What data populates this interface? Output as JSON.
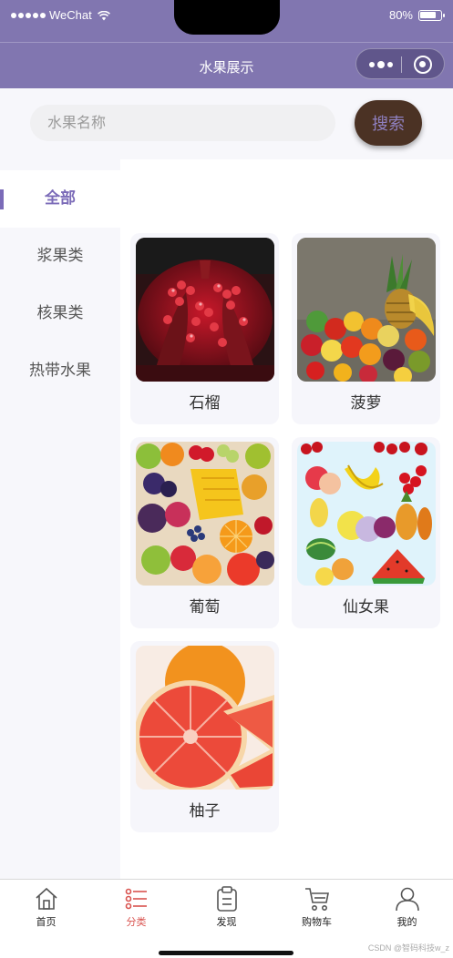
{
  "status": {
    "carrier": "WeChat",
    "battery": "80%",
    "battery_level": 0.8
  },
  "navbar": {
    "title": "水果展示"
  },
  "search": {
    "placeholder": "水果名称",
    "button": "搜索"
  },
  "sidebar": {
    "items": [
      {
        "label": "全部",
        "active": true
      },
      {
        "label": "浆果类",
        "active": false
      },
      {
        "label": "核果类",
        "active": false
      },
      {
        "label": "热带水果",
        "active": false
      }
    ]
  },
  "products": [
    {
      "name": "石榴"
    },
    {
      "name": "菠萝"
    },
    {
      "name": "葡萄"
    },
    {
      "name": "仙女果"
    },
    {
      "name": "柚子"
    }
  ],
  "tabbar": {
    "items": [
      {
        "label": "首页",
        "icon": "home-icon"
      },
      {
        "label": "分类",
        "icon": "category-list-icon",
        "active": true
      },
      {
        "label": "发现",
        "icon": "clipboard-icon"
      },
      {
        "label": "购物车",
        "icon": "cart-icon"
      },
      {
        "label": "我的",
        "icon": "user-icon"
      }
    ]
  },
  "watermark": "CSDN @智码科技w_z",
  "colors": {
    "brand": "#8176b0",
    "accent": "#7b6bb8",
    "search_button": "#4b3224",
    "tab_active": "#d9534f"
  }
}
